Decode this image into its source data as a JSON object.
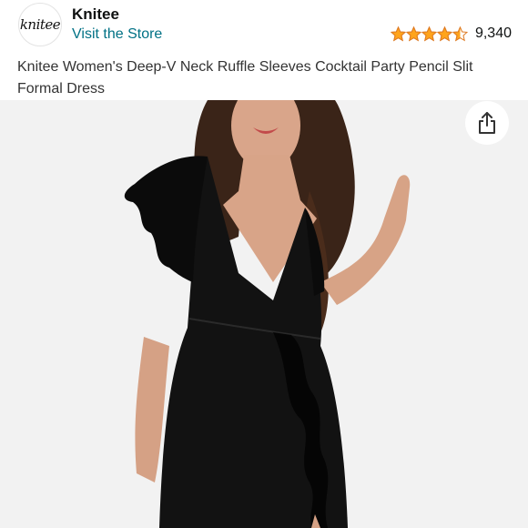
{
  "header": {
    "logo_text": "knitee",
    "brand_name": "Knitee",
    "visit_store_label": "Visit the Store",
    "rating": {
      "stars": 4.5,
      "max_stars": 5,
      "review_count": "9,340",
      "star_color": "#FFA41C"
    }
  },
  "product": {
    "title": "Knitee Women's Deep-V Neck Ruffle Sleeves Cocktail Party Pencil Slit Formal Dress"
  },
  "image": {
    "subject": "model-in-black-dress"
  },
  "icons": {
    "share": "share-icon",
    "star": "star-icon"
  },
  "colors": {
    "link": "#007185",
    "dress": "#111111",
    "background": "#f2f2f2"
  }
}
